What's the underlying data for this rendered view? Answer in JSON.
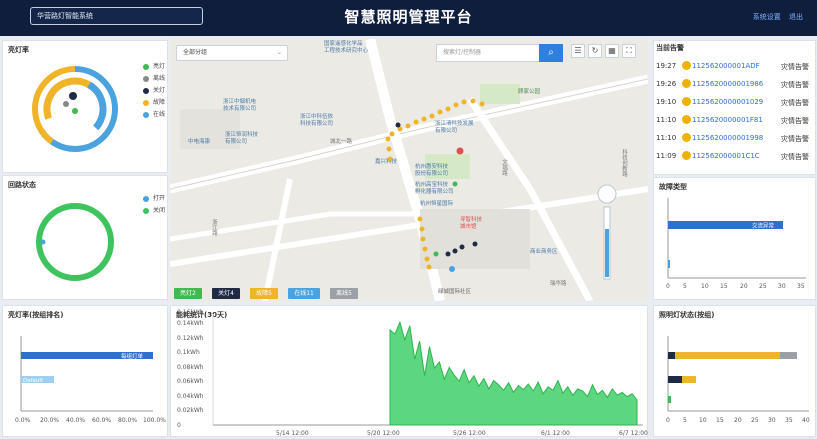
{
  "header": {
    "system_select": "华营路灯智能系统",
    "title": "智慧照明管理平台",
    "links": [
      "系统设置",
      "退出"
    ]
  },
  "p_onrate": {
    "title": "亮灯率",
    "legend": [
      {
        "label": "亮灯",
        "color": "#3fb950"
      },
      {
        "label": "离线",
        "color": "#888888"
      },
      {
        "label": "关灯",
        "color": "#1f2a44"
      },
      {
        "label": "故障",
        "color": "#f0b429"
      },
      {
        "label": "在线",
        "color": "#4aa3df"
      }
    ],
    "chart_data": {
      "type": "pie",
      "categories": [
        "亮灯",
        "离线",
        "关灯",
        "故障",
        "在线"
      ],
      "values": [
        3,
        5,
        4,
        52,
        36
      ]
    }
  },
  "p_loop": {
    "title": "回路状态",
    "legend": [
      {
        "label": "打开",
        "color": "#4aa3df"
      },
      {
        "label": "关闭",
        "color": "#3fc35f"
      }
    ],
    "chart_data": {
      "type": "pie",
      "categories": [
        "打开",
        "关闭"
      ],
      "values": [
        2,
        98
      ]
    }
  },
  "map": {
    "group_select": "全部分组",
    "search_placeholder": "搜索灯/控制器",
    "search_icon": "search-icon",
    "tool_icons": [
      "list-icon",
      "refresh-icon",
      "grid-icon",
      "fullscreen-icon"
    ],
    "labels": [
      "国家遥感化学品",
      "工程技术研究中心",
      "浙江中烟机电",
      "技术有限公司",
      "中电海康",
      "浙江恒润科技",
      "有限公司",
      "浙江中科伍依",
      "科技有限公司",
      "浙江清科技发展",
      "有限公司",
      "杭州惠安科技",
      "股份有限公司",
      "杭州高宝科技",
      "孵化器有限公司",
      "杭州恒星国际",
      "寻智科技",
      "城市馆",
      "顾家公园",
      "绿城国际社区",
      "商业商务区",
      "嘉兴科技",
      "城北一路",
      "浙江路",
      "文瑞路",
      "科技创新路",
      "瑞华路"
    ],
    "stats": [
      {
        "label": "亮灯2",
        "color": "#3fb950"
      },
      {
        "label": "关灯4",
        "color": "#1f2a44"
      },
      {
        "label": "故障5",
        "color": "#f0b429"
      },
      {
        "label": "在线11",
        "color": "#4aa3df"
      },
      {
        "label": "离线5",
        "color": "#9aa0a6"
      }
    ]
  },
  "alarms": {
    "title": "当前告警",
    "rows": [
      {
        "time": "19:27",
        "id": "112562000001ADF",
        "type": "灾情告警"
      },
      {
        "time": "19:26",
        "id": "1125620000001986",
        "type": "灾情告警"
      },
      {
        "time": "19:10",
        "id": "1125620000001029",
        "type": "灾情告警"
      },
      {
        "time": "11:10",
        "id": "1125620000001F81",
        "type": "灾情告警"
      },
      {
        "time": "11:10",
        "id": "1125620000001998",
        "type": "灾情告警"
      },
      {
        "time": "11:09",
        "id": "112562000001C1C",
        "type": "灾情告警"
      }
    ]
  },
  "fault_type": {
    "title": "故障类型",
    "chart_data": {
      "type": "bar",
      "categories": [
        "交流异常",
        ""
      ],
      "values": [
        29,
        0.5
      ],
      "xlim": [
        0,
        35
      ],
      "xticks": [
        "0",
        "5",
        "10",
        "15",
        "20",
        "25",
        "30",
        "35"
      ]
    }
  },
  "rate_rank": {
    "title": "亮灯率(按组排名)",
    "chart_data": {
      "type": "bar",
      "categories": [
        "每组灯单",
        "Default"
      ],
      "values": [
        100,
        25
      ],
      "xticks": [
        "0.0%",
        "20.0%",
        "40.0%",
        "60.0%",
        "80.0%",
        "100.0%"
      ]
    }
  },
  "energy": {
    "title": "能耗统计(30天)",
    "chart_data": {
      "type": "area",
      "xlabel": "",
      "ylabel": "",
      "yticks": [
        "0",
        "0.02kWh",
        "0.04kWh",
        "0.06kWh",
        "0.08kWh",
        "0.1kWh",
        "0.12kWh",
        "0.14kWh",
        "0.16kWh"
      ],
      "xticks": [
        "5/14 12:00",
        "5/20 12:00",
        "5/26 12:00",
        "6/1 12:00",
        "6/7 12:00"
      ],
      "x": [
        0.0,
        0.02,
        0.04,
        0.06,
        0.08,
        0.1,
        0.12,
        0.14,
        0.16,
        0.18,
        0.2,
        0.22,
        0.24,
        0.26,
        0.28,
        0.3,
        0.32,
        0.34,
        0.36,
        0.38,
        0.4,
        0.42,
        0.44,
        0.46,
        0.48,
        0.5,
        0.52,
        0.54,
        0.56,
        0.58,
        0.6,
        0.62,
        0.64,
        0.66,
        0.68,
        0.7,
        0.72,
        0.74,
        0.76,
        0.78,
        0.8,
        0.82,
        0.84,
        0.86,
        0.88,
        0.9,
        0.92,
        0.94,
        0.96,
        0.98,
        1.0
      ],
      "y": [
        0.137,
        0.131,
        0.148,
        0.123,
        0.143,
        0.095,
        0.121,
        0.071,
        0.113,
        0.082,
        0.091,
        0.066,
        0.083,
        0.072,
        0.063,
        0.08,
        0.061,
        0.071,
        0.056,
        0.067,
        0.052,
        0.064,
        0.058,
        0.05,
        0.061,
        0.047,
        0.057,
        0.051,
        0.059,
        0.049,
        0.062,
        0.045,
        0.055,
        0.05,
        0.064,
        0.046,
        0.055,
        0.043,
        0.052,
        0.049,
        0.041,
        0.058,
        0.044,
        0.05,
        0.04,
        0.052,
        0.043,
        0.047,
        0.041,
        0.045,
        0.036
      ]
    }
  },
  "light_status": {
    "title": "照明灯状态(按组)",
    "chart_data": {
      "type": "bar",
      "series": [
        {
          "name": "关灯",
          "values": [
            2,
            4
          ]
        },
        {
          "name": "故障",
          "values": [
            31,
            0
          ]
        },
        {
          "name": "离线",
          "values": [
            5,
            0
          ]
        },
        {
          "name": "在线",
          "values": [
            0,
            1
          ]
        }
      ],
      "xticks": [
        "0",
        "5",
        "10",
        "15",
        "20",
        "25",
        "30",
        "35",
        "40"
      ]
    }
  }
}
